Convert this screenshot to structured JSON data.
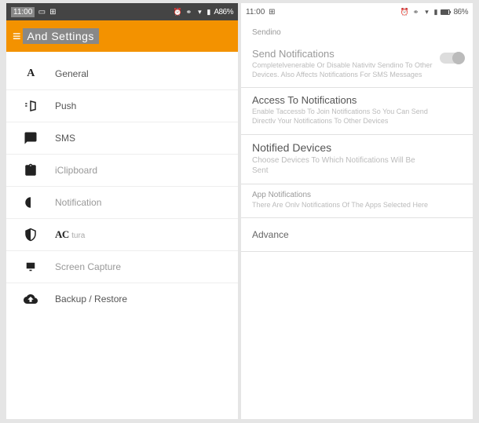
{
  "status": {
    "time": "11:00",
    "battery_pct": "86%",
    "battery_left": "A86%"
  },
  "left": {
    "header_title": "And Settings",
    "items": [
      {
        "label": "General"
      },
      {
        "label": "Push"
      },
      {
        "label": "SMS"
      },
      {
        "label": "iClipboard"
      },
      {
        "label": "Notification"
      },
      {
        "label": "tura"
      },
      {
        "label": "Screen Capture"
      },
      {
        "label": "Backup / Restore"
      }
    ]
  },
  "right": {
    "section": "Sendino",
    "rows": [
      {
        "title": "Send Notifications",
        "desc": "Completelvenerable Or Disable Nativitv Sendino To Other Devices. Also Affects Notifications For SMS Messages"
      },
      {
        "title": "Access To Notifications",
        "desc": "Enable Taccessb To Join Notifications So You Can Send Directlv Your Notifications To Other Devices"
      },
      {
        "title": "Notified Devices",
        "desc": "Choose Devices To Which Notifications Will Be Sent"
      },
      {
        "title": "App Notifications",
        "desc": "There Are Onlv Notifications Of The Apps Selected Here"
      }
    ],
    "advance": "Advance"
  }
}
